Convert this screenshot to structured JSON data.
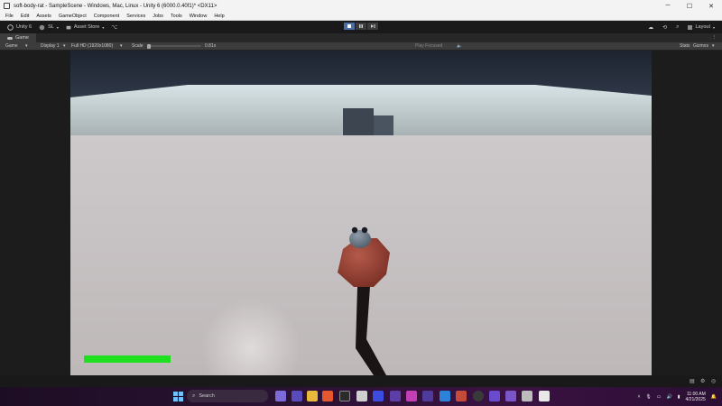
{
  "window": {
    "title": "soft-body-rat - SampleScene - Windows, Mac, Linux - Unity 6 (6000.0.40f1)* <DX11>",
    "controls": [
      "─",
      "☐",
      "✕"
    ]
  },
  "menu": [
    "File",
    "Edit",
    "Assets",
    "GameObject",
    "Component",
    "Services",
    "Jobs",
    "Tools",
    "Window",
    "Help"
  ],
  "toolbar": {
    "account": "Unity 6",
    "user": "SL",
    "asset_store": "Asset Store",
    "layout": "Layout"
  },
  "game_tab": {
    "label": "Game"
  },
  "game_toolbar": {
    "view": "Game",
    "display": "Display 1",
    "resolution": "Full HD (1920x1080)",
    "scale_label": "Scale",
    "scale_value": "0.81x",
    "play_mode": "Play Focused",
    "stats": "Stats",
    "gizmos": "Gizmos"
  },
  "hud": {
    "health_fraction": 1.0,
    "health_color": "#1fe01f"
  },
  "taskbar": {
    "search_placeholder": "Search",
    "time": "11:00 AM",
    "date": "4/21/2025"
  },
  "colors": {
    "editor_bg": "#191919",
    "sky": "#262d3a",
    "floor": "#c2bcbd",
    "rat_body": "#9e4537",
    "rat_head": "#6f7d8e"
  }
}
